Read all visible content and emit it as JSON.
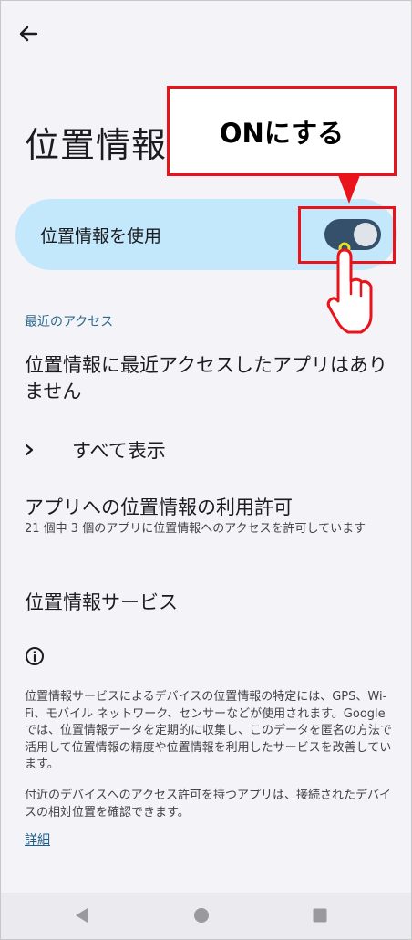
{
  "header": {
    "title": "位置情報"
  },
  "master_switch": {
    "label": "位置情報を使用",
    "state": "on"
  },
  "annotation": {
    "callout_text": "ONにする",
    "accent_color": "#e8131b"
  },
  "recent_access": {
    "section_label": "最近のアクセス",
    "empty_text": "位置情報に最近アクセスしたアプリはありません",
    "see_all_label": "すべて表示"
  },
  "app_permission": {
    "title": "アプリへの位置情報の利用許可",
    "summary": "21 個中 3 個のアプリに位置情報へのアクセスを許可しています"
  },
  "location_services": {
    "title": "位置情報サービス"
  },
  "footer": {
    "description": "位置情報サービスによるデバイスの位置情報の特定には、GPS、Wi-Fi、モバイル ネットワーク、センサーなどが使用されます。Google では、位置情報データを定期的に収集し、このデータを匿名の方法で活用して位置情報の精度や位置情報を利用したサービスを改善しています。",
    "nearby_text": "付近のデバイスへのアクセス許可を持つアプリは、接続されたデバイスの相対位置を確認できます。",
    "learn_more": "詳細"
  },
  "icons": [
    "back-arrow-icon",
    "chevron-right-icon",
    "info-icon",
    "nav-back-icon",
    "nav-home-icon",
    "nav-recents-icon",
    "pointing-hand-icon"
  ]
}
